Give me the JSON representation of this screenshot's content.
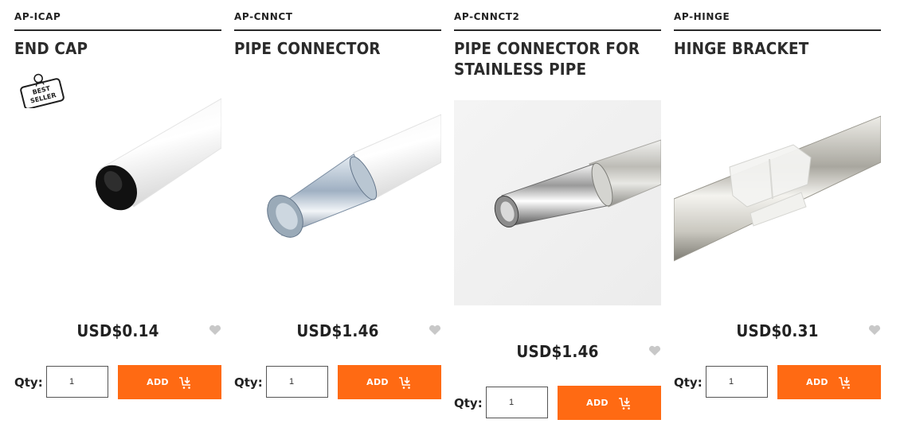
{
  "colors": {
    "accent": "#ff6a13",
    "text": "#222222",
    "rule": "#2a2a2a",
    "heart": "#c8c8c8"
  },
  "products": [
    {
      "sku": "AP-ICAP",
      "title": "END CAP",
      "price": "USD$0.14",
      "qty_label": "Qty:",
      "qty_value": "1",
      "add_label": "ADD",
      "badge": {
        "line1": "BEST",
        "line2": "SELLER"
      }
    },
    {
      "sku": "AP-CNNCT",
      "title": "PIPE CONNECTOR",
      "price": "USD$1.46",
      "qty_label": "Qty:",
      "qty_value": "1",
      "add_label": "ADD"
    },
    {
      "sku": "AP-CNNCT2",
      "title": "PIPE CONNECTOR FOR STAINLESS PIPE",
      "price": "USD$1.46",
      "qty_label": "Qty:",
      "qty_value": "1",
      "add_label": "ADD"
    },
    {
      "sku": "AP-HINGE",
      "title": "HINGE BRACKET",
      "price": "USD$0.31",
      "qty_label": "Qty:",
      "qty_value": "1",
      "add_label": "ADD"
    }
  ],
  "icons": {
    "wishlist": "heart-icon",
    "cart": "cart-add-icon",
    "badge": "best-seller-icon"
  }
}
